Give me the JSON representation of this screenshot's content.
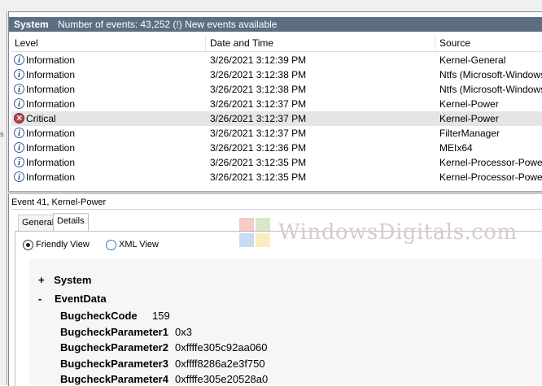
{
  "titlebar": {
    "log_name": "System",
    "summary": "Number of events: 43,252 (!) New events available"
  },
  "columns": {
    "level": "Level",
    "datetime": "Date and Time",
    "source": "Source"
  },
  "events": [
    {
      "level": "Information",
      "datetime": "3/26/2021 3:12:39 PM",
      "source": "Kernel-General",
      "icon": "info"
    },
    {
      "level": "Information",
      "datetime": "3/26/2021 3:12:38 PM",
      "source": "Ntfs (Microsoft-Windows",
      "icon": "info"
    },
    {
      "level": "Information",
      "datetime": "3/26/2021 3:12:38 PM",
      "source": "Ntfs (Microsoft-Windows",
      "icon": "info"
    },
    {
      "level": "Information",
      "datetime": "3/26/2021 3:12:37 PM",
      "source": "Kernel-Power",
      "icon": "info"
    },
    {
      "level": "Critical",
      "datetime": "3/26/2021 3:12:37 PM",
      "source": "Kernel-Power",
      "icon": "critical"
    },
    {
      "level": "Information",
      "datetime": "3/26/2021 3:12:37 PM",
      "source": "FilterManager",
      "icon": "info"
    },
    {
      "level": "Information",
      "datetime": "3/26/2021 3:12:36 PM",
      "source": "MEIx64",
      "icon": "info"
    },
    {
      "level": "Information",
      "datetime": "3/26/2021 3:12:35 PM",
      "source": "Kernel-Processor-Power (",
      "icon": "info"
    },
    {
      "level": "Information",
      "datetime": "3/26/2021 3:12:35 PM",
      "source": "Kernel-Processor-Power (",
      "icon": "info"
    }
  ],
  "detail": {
    "title": "Event 41, Kernel-Power",
    "tabs": [
      "General",
      "Details"
    ],
    "view_options": [
      "Friendly View",
      "XML View"
    ],
    "tree": {
      "system": {
        "toggle": "+",
        "label": "System"
      },
      "eventdata": {
        "toggle": "-",
        "label": "EventData"
      },
      "fields": [
        {
          "name": "BugcheckCode",
          "value": "159"
        },
        {
          "name": "BugcheckParameter1",
          "value": "0x3"
        },
        {
          "name": "BugcheckParameter2",
          "value": "0xffffe305c92aa060"
        },
        {
          "name": "BugcheckParameter3",
          "value": "0xffff8286a2e3f750"
        },
        {
          "name": "BugcheckParameter4",
          "value": "0xffffe305e20528a0"
        }
      ]
    }
  },
  "watermark": {
    "text": "WindowsDigitals.com"
  },
  "colors": {
    "titlebar": "#5c6f82",
    "selected_row": "#e5e5e5",
    "critical": "#b3444b",
    "info": "#1f4fa0"
  }
}
